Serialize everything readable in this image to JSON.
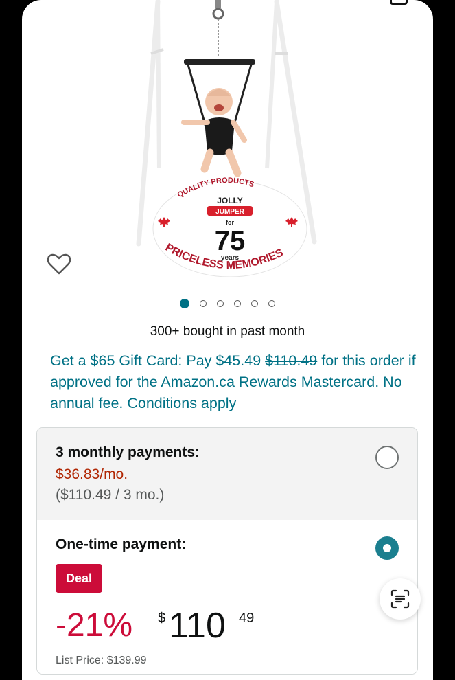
{
  "product": {
    "image_alt": "Jolly Jumper baby exerciser with stand",
    "badge_text": {
      "arc_top": "QUALITY PRODUCTS",
      "brand_line1": "JOLLY",
      "brand_line2": "JUMPER",
      "for": "for",
      "years_number": "75",
      "years": "years",
      "arc_bottom": "PRICELESS MEMORIES"
    },
    "image_count": 6,
    "active_image": 0
  },
  "social_proof": "300+ bought in past month",
  "promo": {
    "prefix": "Get a $65 Gift Card: Pay $45.49 ",
    "strike_price": "$110.49",
    "suffix": " for this order if approved for the Amazon.ca Rewards Mastercard. No annual fee. Conditions apply"
  },
  "payment_options": {
    "monthly": {
      "title": "3 monthly payments:",
      "price": "$36.83/mo.",
      "detail": "($110.49 / 3 mo.)",
      "selected": false
    },
    "one_time": {
      "title": "One-time payment:",
      "deal_label": "Deal",
      "discount": "-21%",
      "currency_symbol": "$",
      "price_whole": "110",
      "price_fraction": "49",
      "list_price_label": "List Price: $139.99",
      "selected": true
    }
  },
  "icons": {
    "wishlist": "heart-outline-icon",
    "scan": "text-scan-icon"
  },
  "colors": {
    "link_teal": "#007185",
    "price_red": "#b12704",
    "deal_red": "#cc0c39",
    "radio_selected": "#1b7f8f"
  }
}
